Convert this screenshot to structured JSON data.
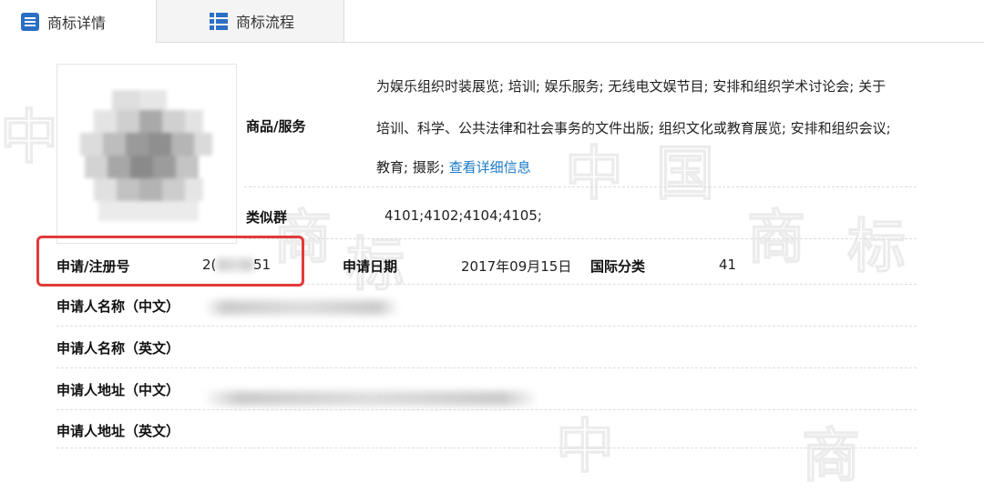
{
  "tabs": [
    {
      "label": "商标详情",
      "icon": "list-icon",
      "active": true
    },
    {
      "label": "商标流程",
      "icon": "grid-list-icon",
      "active": false
    }
  ],
  "goods": {
    "label": "商品/服务",
    "lines": [
      "为娱乐组织时装展览; 培训; 娱乐服务; 无线电文娱节目; 安排和组织学术讨论会; 关于",
      "培训、科学、公共法律和社会事务的文件出版; 组织文化或教育展览; 安排和组织会议;"
    ],
    "last_line_text": "教育; 摄影; ",
    "detail_link": "查看详细信息"
  },
  "similar_group": {
    "label": "类似群",
    "value": "4101;4102;4104;4105;"
  },
  "registration": {
    "label": "申请/注册号",
    "value_start": "2(",
    "value_end": "51",
    "date_label": "申请日期",
    "date_value": "2017年09月15日",
    "intl_label": "国际分类",
    "intl_value": "41"
  },
  "applicant": {
    "name_cn_label": "申请人名称（中文）",
    "name_en_label": "申请人名称（英文）",
    "addr_cn_label": "申请人地址（中文）",
    "addr_en_label": "申请人地址（英文）"
  },
  "colors": {
    "highlight": "#e23a3a",
    "link": "#1a79c7",
    "tab_icon": "#2b6fc4"
  }
}
